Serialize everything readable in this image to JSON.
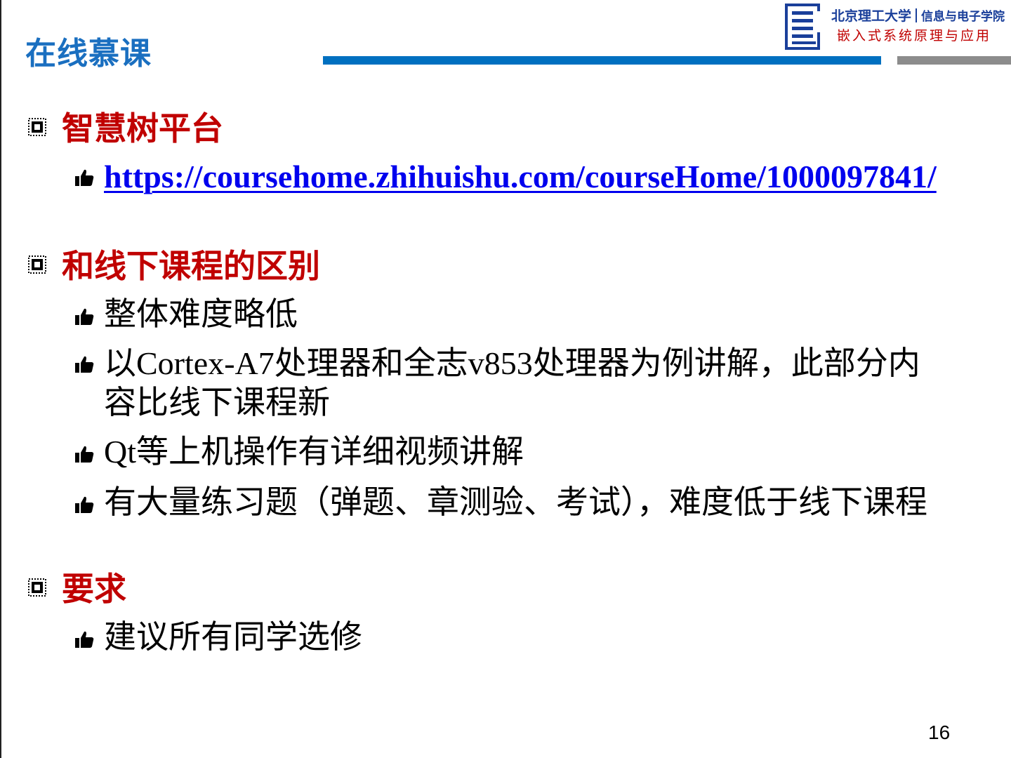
{
  "header": {
    "title": "在线慕课",
    "university": "北京理工大学",
    "department": "信息与电子学院",
    "course": "嵌入式系统原理与应用",
    "logo_icon": "university-emblem-icon"
  },
  "sections": [
    {
      "heading": "智慧树平台",
      "items": [
        "https://coursehome.zhihuishu.com/courseHome/1000097841/"
      ]
    },
    {
      "heading": "和线下课程的区别",
      "items": [
        "整体难度略低",
        "以Cortex-A7处理器和全志v853处理器为例讲解，此部分内容比线下课程新",
        "Qt等上机操作有详细视频讲解",
        "有大量练习题（弹题、章测验、考试），难度低于线下课程"
      ]
    },
    {
      "heading": "要求",
      "items": [
        "建议所有同学选修"
      ]
    }
  ],
  "footer": {
    "page_number": "16"
  },
  "colors": {
    "title": "#1a6fc0",
    "heading": "#c00000",
    "link": "#0000ee",
    "accent_bar": "#0070c0",
    "gray_bar": "#8c8c8c"
  },
  "icons": {
    "section_bullet": "chip-bullet-icon",
    "item_bullet": "thumbs-up-icon"
  }
}
